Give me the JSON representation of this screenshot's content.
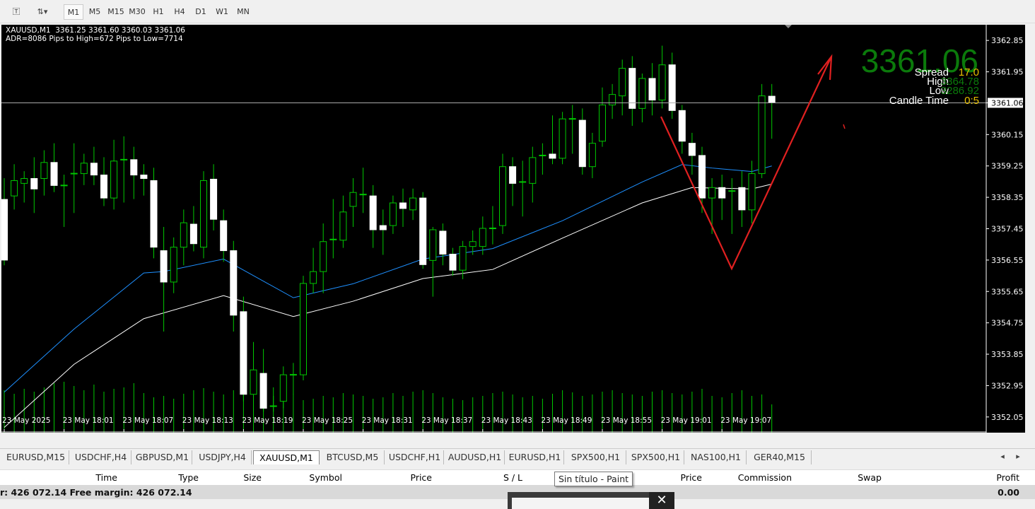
{
  "toolbar": {
    "timeframes": [
      "M1",
      "M5",
      "M15",
      "M30",
      "H1",
      "H4",
      "D1",
      "W1",
      "MN"
    ],
    "active": "M1"
  },
  "chart": {
    "symbol_line": "XAUUSD,M1  3361.25 3361.60 3360.03 3361.06",
    "adr_line": "ADR=8086 Pips to High=672 Pips to Low=7714",
    "big_price": "3361.06",
    "spread_label": "Spread",
    "spread_value": "17.0",
    "high_label": "High",
    "high_value": "3364.78",
    "low_label": "Low",
    "low_value": "3286.92",
    "candle_time_label": "Candle Time",
    "candle_time_value": "0:5",
    "current_price_label": "3361.06",
    "colors": {
      "bull": "#00c800",
      "bear_body": "#ffffff",
      "ma_fast": "#1e90ff",
      "ma_slow": "#ffffff",
      "volume": "#00c800",
      "annotation": "#e02020",
      "big_price": "#0b7a0b",
      "value_yellow": "#e8c000"
    }
  },
  "chart_data": {
    "type": "candlestick",
    "ylim": [
      3351.6,
      3363.3
    ],
    "y_ticks": [
      "3362.85",
      "3361.95",
      "3361.06",
      "3360.15",
      "3359.25",
      "3358.35",
      "3357.45",
      "3356.55",
      "3355.65",
      "3354.75",
      "3353.85",
      "3352.95",
      "3352.05"
    ],
    "x_ticks": [
      "23 May 2025",
      "23 May 18:01",
      "23 May 18:07",
      "23 May 18:13",
      "23 May 18:19",
      "23 May 18:25",
      "23 May 18:31",
      "23 May 18:37",
      "23 May 18:43",
      "23 May 18:49",
      "23 May 18:55",
      "23 May 19:01",
      "23 May 19:07"
    ],
    "ohlc": [
      [
        3358.29,
        3358.9,
        3356.4,
        3356.55
      ],
      [
        3358.39,
        3359.3,
        3358.0,
        3358.83
      ],
      [
        3358.75,
        3359.1,
        3358.2,
        3358.89
      ],
      [
        3358.89,
        3359.5,
        3357.9,
        3358.59
      ],
      [
        3358.89,
        3359.7,
        3358.4,
        3359.35
      ],
      [
        3359.35,
        3359.9,
        3358.5,
        3358.69
      ],
      [
        3358.69,
        3359.0,
        3357.5,
        3358.7
      ],
      [
        3359.03,
        3359.9,
        3357.9,
        3359.04
      ],
      [
        3359.03,
        3359.6,
        3358.7,
        3359.33
      ],
      [
        3359.33,
        3359.8,
        3358.7,
        3358.99
      ],
      [
        3358.99,
        3359.5,
        3358.1,
        3358.33
      ],
      [
        3358.33,
        3360.0,
        3358.0,
        3359.39
      ],
      [
        3359.43,
        3360.1,
        3358.2,
        3359.44
      ],
      [
        3359.43,
        3359.8,
        3358.3,
        3358.99
      ],
      [
        3358.99,
        3359.3,
        3358.4,
        3358.89
      ],
      [
        3358.83,
        3359.2,
        3356.6,
        3356.92
      ],
      [
        3356.82,
        3357.5,
        3354.5,
        3355.92
      ],
      [
        3355.92,
        3357.2,
        3355.6,
        3356.92
      ],
      [
        3356.92,
        3358.0,
        3356.4,
        3357.62
      ],
      [
        3357.58,
        3358.1,
        3356.8,
        3357.02
      ],
      [
        3356.92,
        3359.1,
        3356.6,
        3358.83
      ],
      [
        3358.87,
        3359.3,
        3357.4,
        3357.72
      ],
      [
        3357.68,
        3358.0,
        3356.5,
        3356.82
      ],
      [
        3356.82,
        3357.1,
        3354.5,
        3354.97
      ],
      [
        3355.07,
        3355.5,
        3352.5,
        3352.7
      ],
      [
        3352.7,
        3354.2,
        3352.4,
        3353.4
      ],
      [
        3353.3,
        3354.0,
        3352.2,
        3352.3
      ],
      [
        3352.36,
        3352.9,
        3352.2,
        3352.37
      ],
      [
        3352.5,
        3353.5,
        3352.3,
        3353.26
      ],
      [
        3353.26,
        3353.6,
        3352.7,
        3353.27
      ],
      [
        3353.26,
        3356.1,
        3353.1,
        3355.88
      ],
      [
        3355.88,
        3356.9,
        3355.6,
        3356.22
      ],
      [
        3356.22,
        3357.6,
        3355.6,
        3357.08
      ],
      [
        3357.14,
        3358.3,
        3356.6,
        3357.15
      ],
      [
        3357.12,
        3358.4,
        3356.9,
        3357.93
      ],
      [
        3358.09,
        3358.9,
        3357.5,
        3358.49
      ],
      [
        3358.43,
        3359.2,
        3357.9,
        3358.44
      ],
      [
        3358.39,
        3358.7,
        3356.9,
        3357.42
      ],
      [
        3357.54,
        3358.0,
        3356.7,
        3357.42
      ],
      [
        3357.54,
        3358.4,
        3357.3,
        3358.19
      ],
      [
        3358.19,
        3358.6,
        3357.5,
        3358.03
      ],
      [
        3357.99,
        3358.6,
        3357.7,
        3358.33
      ],
      [
        3358.33,
        3358.5,
        3356.3,
        3356.42
      ],
      [
        3356.54,
        3357.5,
        3355.5,
        3357.42
      ],
      [
        3357.38,
        3357.6,
        3356.4,
        3356.72
      ],
      [
        3356.72,
        3356.9,
        3356.1,
        3356.26
      ],
      [
        3356.26,
        3357.1,
        3356.0,
        3356.94
      ],
      [
        3356.94,
        3357.4,
        3356.7,
        3357.08
      ],
      [
        3356.94,
        3357.8,
        3356.7,
        3357.46
      ],
      [
        3357.46,
        3358.1,
        3357.0,
        3357.47
      ],
      [
        3357.54,
        3359.6,
        3357.3,
        3359.23
      ],
      [
        3359.23,
        3359.5,
        3358.1,
        3358.75
      ],
      [
        3358.79,
        3359.4,
        3357.8,
        3358.8
      ],
      [
        3358.75,
        3359.8,
        3358.2,
        3359.49
      ],
      [
        3359.55,
        3359.9,
        3359.0,
        3359.56
      ],
      [
        3359.59,
        3360.7,
        3359.3,
        3359.47
      ],
      [
        3359.47,
        3360.8,
        3359.3,
        3360.6
      ],
      [
        3360.6,
        3361.0,
        3359.6,
        3360.61
      ],
      [
        3360.56,
        3360.9,
        3359.0,
        3359.23
      ],
      [
        3359.23,
        3360.2,
        3358.9,
        3359.9
      ],
      [
        3359.96,
        3361.5,
        3359.8,
        3361.0
      ],
      [
        3361.0,
        3361.6,
        3360.6,
        3361.3
      ],
      [
        3361.26,
        3362.3,
        3360.7,
        3362.05
      ],
      [
        3362.05,
        3362.4,
        3360.4,
        3360.9
      ],
      [
        3360.9,
        3361.9,
        3360.5,
        3361.76
      ],
      [
        3361.76,
        3362.2,
        3360.7,
        3361.14
      ],
      [
        3361.14,
        3362.7,
        3360.9,
        3362.15
      ],
      [
        3362.15,
        3362.5,
        3360.6,
        3360.84
      ],
      [
        3360.84,
        3361.0,
        3359.6,
        3359.96
      ],
      [
        3359.9,
        3360.2,
        3359.0,
        3359.55
      ],
      [
        3359.55,
        3359.8,
        3357.9,
        3358.33
      ],
      [
        3358.33,
        3358.9,
        3357.3,
        3358.63
      ],
      [
        3358.63,
        3359.0,
        3357.7,
        3358.33
      ],
      [
        3358.53,
        3358.9,
        3357.3,
        3358.54
      ],
      [
        3358.63,
        3359.1,
        3357.5,
        3357.99
      ],
      [
        3357.99,
        3359.4,
        3357.6,
        3359.03
      ],
      [
        3359.03,
        3361.6,
        3358.9,
        3361.26
      ],
      [
        3361.25,
        3361.6,
        3360.03,
        3361.06
      ]
    ],
    "volume": [
      60,
      55,
      62,
      58,
      64,
      70,
      72,
      66,
      60,
      68,
      58,
      62,
      64,
      70,
      56,
      50,
      52,
      48,
      55,
      60,
      63,
      58,
      54,
      60,
      66,
      62,
      58,
      52,
      50,
      55,
      46,
      48,
      52,
      50,
      56,
      54,
      52,
      48,
      50,
      56,
      52,
      58,
      60,
      56,
      50,
      48,
      46,
      50,
      52,
      56,
      58,
      54,
      50,
      52,
      48,
      55,
      60,
      57,
      52,
      54,
      58,
      60,
      56,
      54,
      52,
      58,
      60,
      56,
      54,
      58,
      62,
      52,
      50,
      56,
      60,
      52,
      54,
      40
    ],
    "ma_fast": [
      [
        0,
        3352.76
      ],
      [
        7,
        3354.57
      ],
      [
        14,
        3356.18
      ],
      [
        16,
        3356.22
      ],
      [
        22,
        3356.58
      ],
      [
        29,
        3355.47
      ],
      [
        35,
        3355.87
      ],
      [
        42,
        3356.58
      ],
      [
        49,
        3356.88
      ],
      [
        56,
        3357.68
      ],
      [
        64,
        3358.79
      ],
      [
        68,
        3359.29
      ],
      [
        71,
        3359.19
      ],
      [
        75,
        3359.09
      ],
      [
        77,
        3359.25
      ]
    ],
    "ma_slow": [
      [
        0,
        3351.75
      ],
      [
        7,
        3353.56
      ],
      [
        14,
        3354.87
      ],
      [
        22,
        3355.53
      ],
      [
        29,
        3354.93
      ],
      [
        35,
        3355.37
      ],
      [
        42,
        3356.02
      ],
      [
        49,
        3356.28
      ],
      [
        56,
        3357.18
      ],
      [
        64,
        3358.19
      ],
      [
        69,
        3358.63
      ],
      [
        75,
        3358.59
      ],
      [
        77,
        3358.73
      ]
    ]
  },
  "symbol_tabs": [
    "EURUSD,M15",
    "USDCHF,H4",
    "GBPUSD,M1",
    "USDJPY,H4",
    "XAUUSD,M1",
    "BTCUSD,M5",
    "USDCHF,H1",
    "AUDUSD,H1",
    "EURUSD,H1",
    "SPX500,H1",
    "SPX500,H1",
    "NAS100,H1",
    "GER40,M15"
  ],
  "active_tab": "XAUUSD,M1",
  "table": {
    "headers": [
      "Time",
      "Type",
      "Size",
      "Symbol",
      "Price",
      "S / L",
      "Price",
      "Commission",
      "Swap",
      "Profit"
    ],
    "balance_row": "r: 426 072.14  Free margin: 426 072.14",
    "profit": "0.00"
  },
  "tooltip": "Sin título - Paint"
}
